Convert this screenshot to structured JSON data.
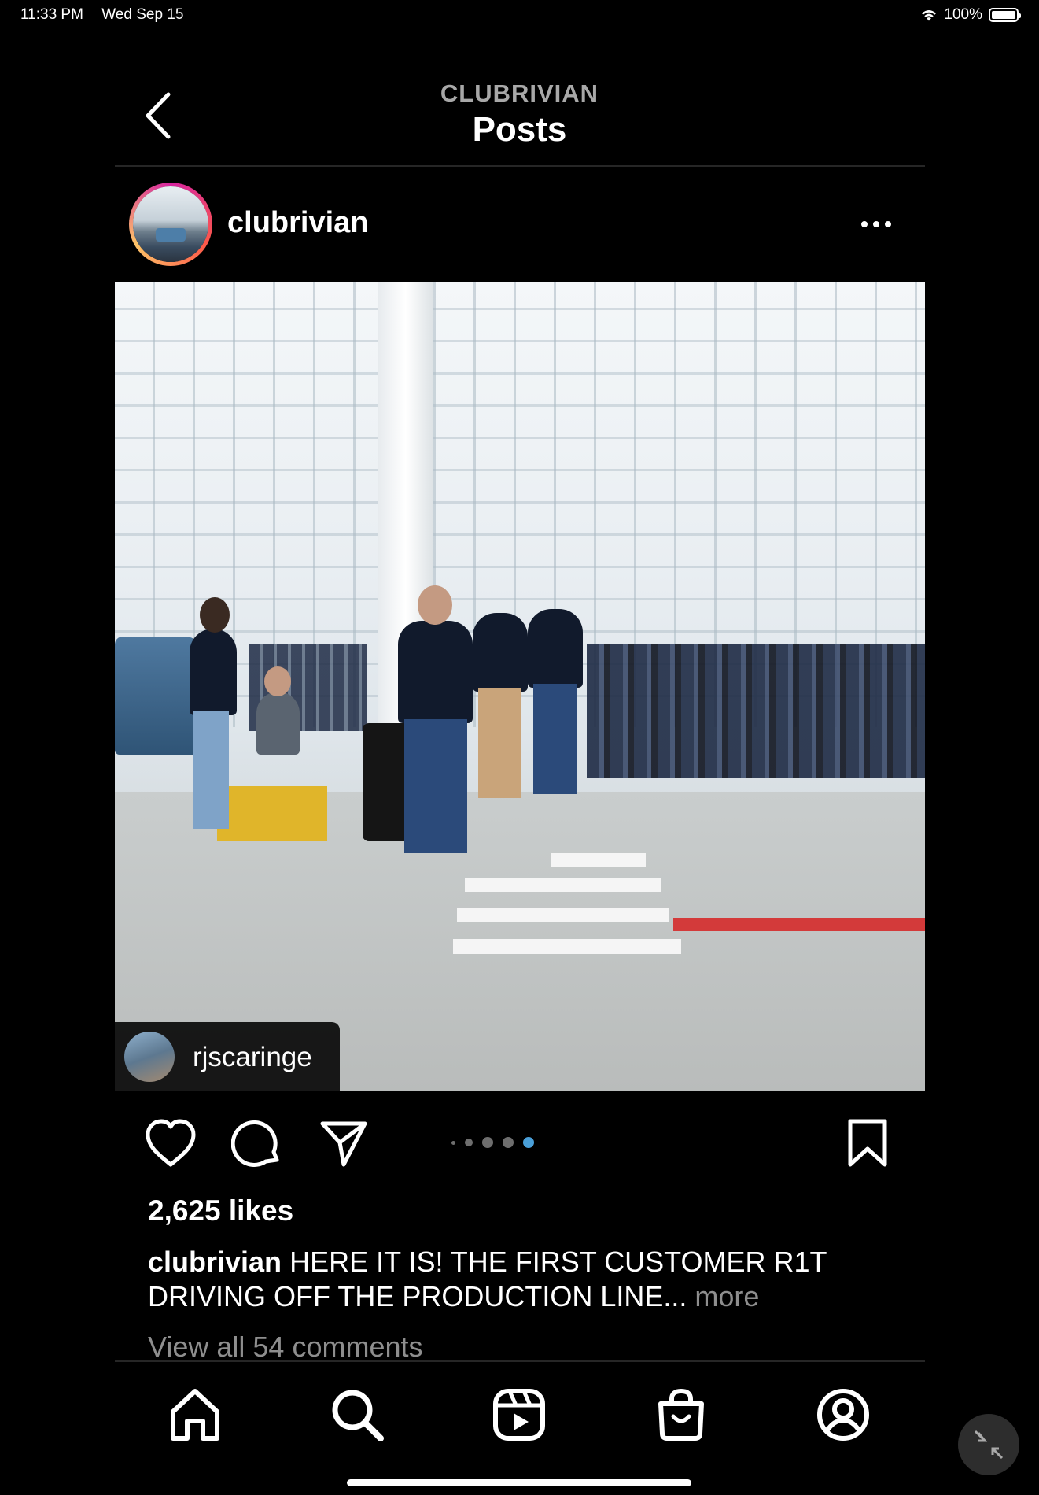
{
  "status_bar": {
    "time": "11:33 PM",
    "date": "Wed Sep 15",
    "battery": "100%",
    "battery_level": 1.0,
    "wifi_icon": "wifi-icon"
  },
  "header": {
    "subtitle": "CLUBRIVIAN",
    "title": "Posts",
    "back_icon": "chevron-left-icon"
  },
  "post": {
    "username": "clubrivian",
    "more_icon": "more-horizontal-icon",
    "tagged_user": "rjscaringe",
    "carousel": {
      "total_dots": 5,
      "active_index": 4
    },
    "likes": "2,625 likes",
    "caption_user": "clubrivian",
    "caption_text": "HERE IT IS! THE FIRST CUSTOMER R1T DRIVING OFF THE PRODUCTION LINE...",
    "caption_more": "more",
    "view_comments": "View all 54 comments",
    "actions": [
      "heart-icon",
      "comment-icon",
      "share-icon",
      "bookmark-icon"
    ]
  },
  "bottom_nav": {
    "items": [
      "home-icon",
      "search-icon",
      "reels-icon",
      "shop-icon",
      "profile-icon"
    ]
  },
  "colors": {
    "background": "#000000",
    "muted_text": "#8e8e8e",
    "active_dot": "#4a9fd8",
    "story_ring": [
      "#d6249f",
      "#fd5949",
      "#fdc468"
    ]
  }
}
